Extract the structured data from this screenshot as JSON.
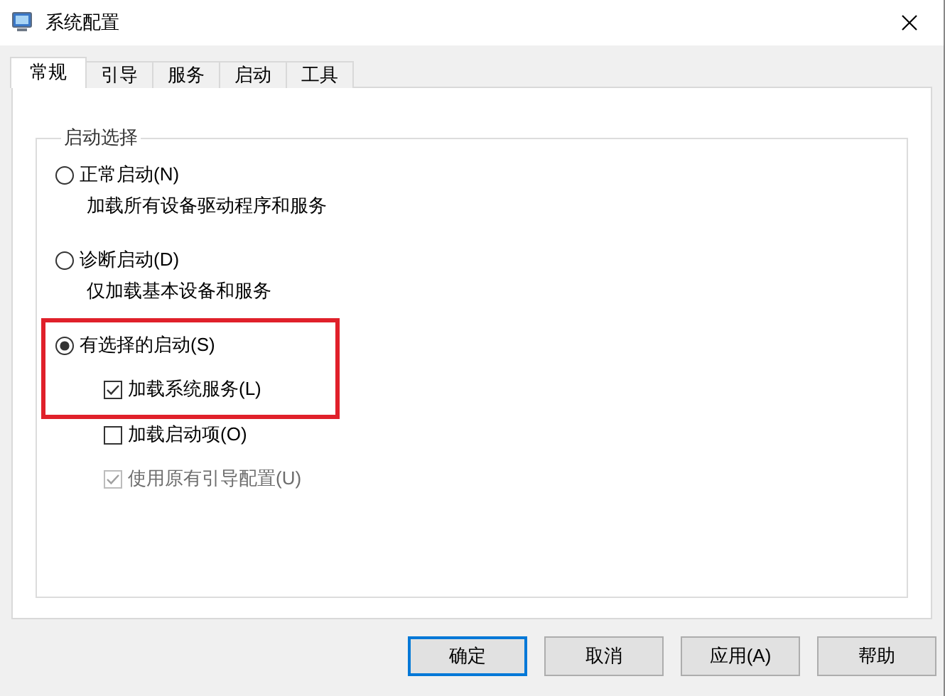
{
  "window": {
    "title": "系统配置"
  },
  "tabs": [
    {
      "label": "常规",
      "selected": true
    },
    {
      "label": "引导",
      "selected": false
    },
    {
      "label": "服务",
      "selected": false
    },
    {
      "label": "启动",
      "selected": false
    },
    {
      "label": "工具",
      "selected": false
    }
  ],
  "group": {
    "title": "启动选择",
    "rows": [
      {
        "kind": "radio",
        "label": "正常启动(N)",
        "selected": false,
        "highlighted": false
      },
      {
        "kind": "note",
        "label": "加载所有设备驱动程序和服务",
        "highlighted": false
      },
      {
        "kind": "radio",
        "label": "诊断启动(D)",
        "selected": false,
        "highlighted": false
      },
      {
        "kind": "note",
        "label": "仅加载基本设备和服务",
        "highlighted": false
      },
      {
        "kind": "radio",
        "label": "有选择的启动(S)",
        "selected": true,
        "highlighted": true
      },
      {
        "kind": "check",
        "label": "加载系统服务(L)",
        "checked": true,
        "disabled": false,
        "highlighted": true
      },
      {
        "kind": "check",
        "label": "加载启动项(O)",
        "checked": false,
        "disabled": false,
        "highlighted": false
      },
      {
        "kind": "check",
        "label": "使用原有引导配置(U)",
        "checked": true,
        "disabled": true,
        "highlighted": false
      }
    ]
  },
  "buttons": [
    {
      "label": "确定",
      "default": true
    },
    {
      "label": "取消",
      "default": false
    },
    {
      "label": "应用(A)",
      "default": false
    },
    {
      "label": "帮助",
      "default": false
    }
  ]
}
